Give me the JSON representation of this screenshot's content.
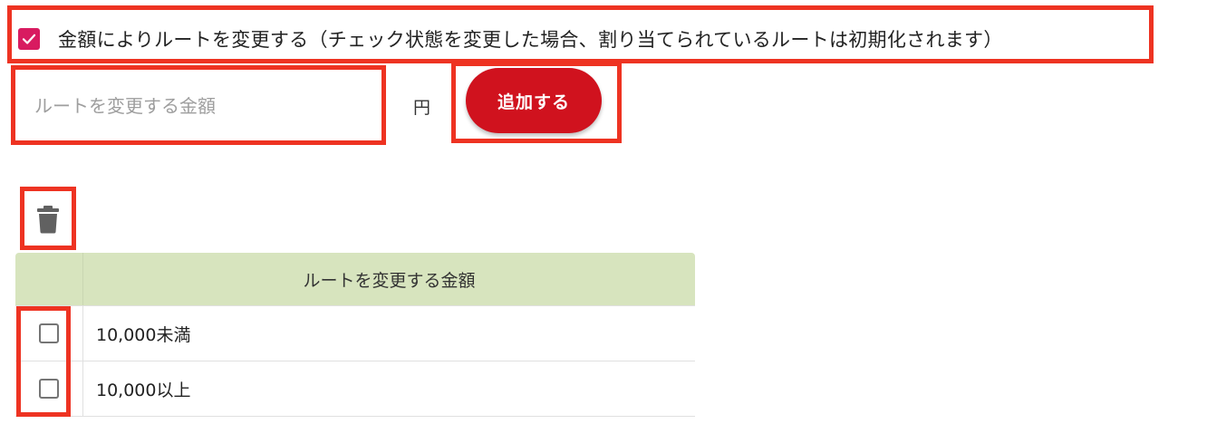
{
  "route_toggle": {
    "checked": true,
    "label": "金額によりルートを変更する（チェック状態を変更した場合、割り当てられているルートは初期化されます）"
  },
  "amount_form": {
    "placeholder": "ルートを変更する金額",
    "unit": "円",
    "add_label": "追加する"
  },
  "toolbar": {
    "delete_icon": "trash-icon"
  },
  "table": {
    "header_amount": "ルートを変更する金額",
    "rows": [
      {
        "checked": false,
        "amount": "10,000未満"
      },
      {
        "checked": false,
        "amount": "10,000以上"
      }
    ]
  },
  "colors": {
    "accent": "#d81b60",
    "button": "#d0121e",
    "header_bg": "#d7e4be",
    "highlight": "#ee3322"
  }
}
